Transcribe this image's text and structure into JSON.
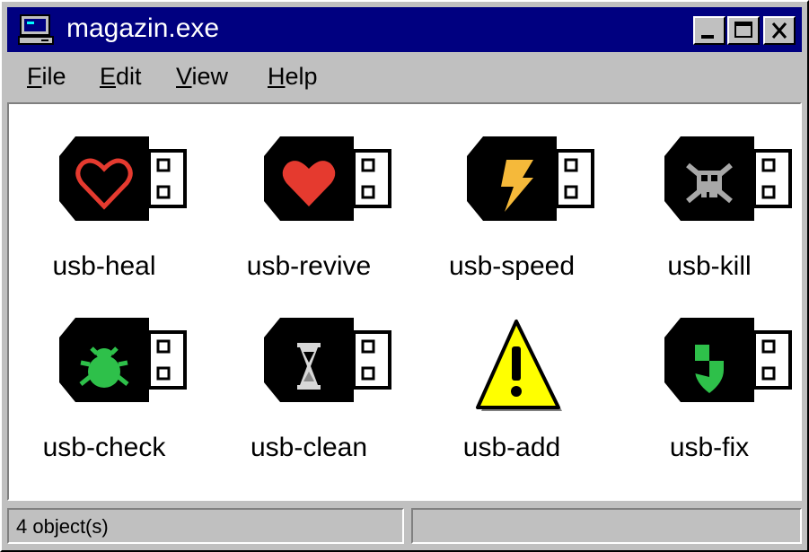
{
  "window": {
    "title": "magazin.exe",
    "titlebar_color": "#000080",
    "icons": [
      "computer-icon",
      "minimize-icon",
      "maximize-icon",
      "close-icon"
    ]
  },
  "menubar": {
    "items": [
      {
        "accel": "F",
        "rest": "ile"
      },
      {
        "accel": "E",
        "rest": "dit"
      },
      {
        "accel": "V",
        "rest": "iew"
      },
      {
        "accel": "H",
        "rest": "elp"
      }
    ]
  },
  "items": [
    {
      "label": "usb-heal",
      "icon": "heart-outline-icon",
      "color": "#e53a2f"
    },
    {
      "label": "usb-revive",
      "icon": "heart-filled-icon",
      "color": "#e53a2f"
    },
    {
      "label": "usb-speed",
      "icon": "lightning-icon",
      "color": "#f5b93a"
    },
    {
      "label": "usb-kill",
      "icon": "skull-crossbones-icon",
      "color": "#a8a8a8"
    },
    {
      "label": "usb-check",
      "icon": "bug-icon",
      "color": "#2ec04a"
    },
    {
      "label": "usb-clean",
      "icon": "hourglass-icon",
      "color": "#d8d8d8"
    },
    {
      "label": "usb-add",
      "icon": "warning-icon",
      "color": "#ffff00"
    },
    {
      "label": "usb-fix",
      "icon": "shield-icon",
      "color": "#2ec04a"
    }
  ],
  "statusbar": {
    "text": "4 object(s)",
    "right": ""
  }
}
